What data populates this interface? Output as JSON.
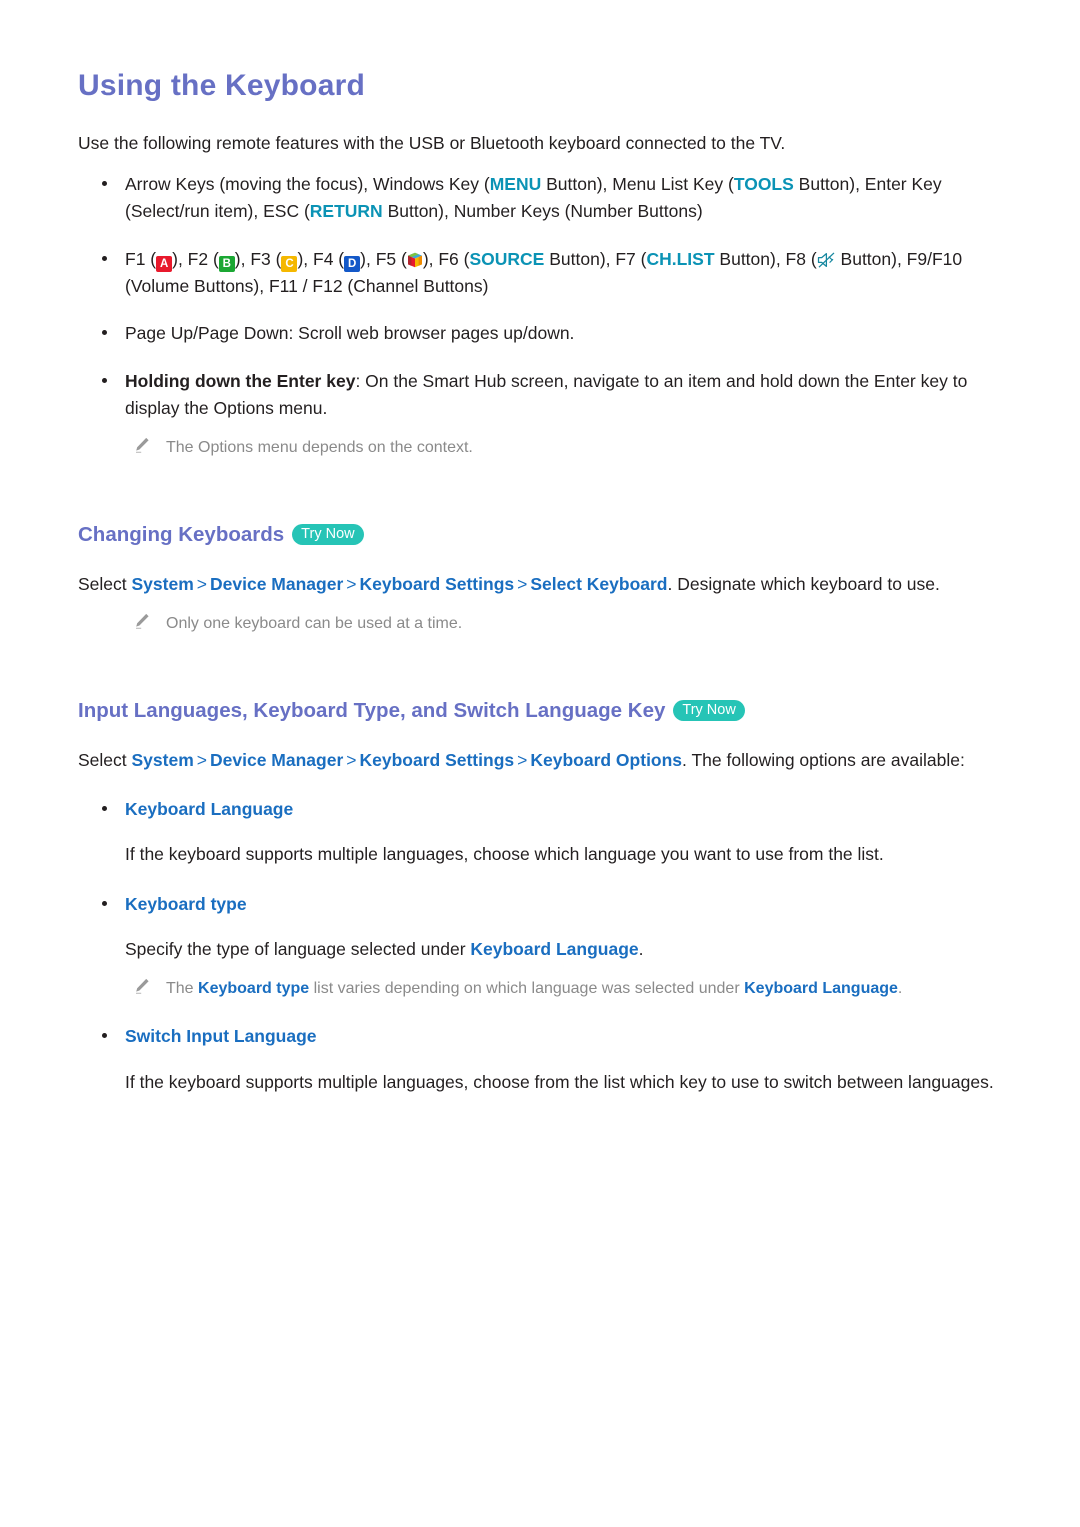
{
  "document": {
    "title": "Using the Keyboard",
    "intro": "Use the following remote features with the USB or Bluetooth keyboard connected to the TV."
  },
  "colors": {
    "heading_purple": "#6770c4",
    "keyword_teal": "#0b93b5",
    "link_blue": "#1a6ec0",
    "trynow_badge": "#26c4b6",
    "note_gray": "#8a8a8a",
    "badge_a_red": "#e8192c",
    "badge_b_green": "#1ba733",
    "badge_c_yellow": "#f5b800",
    "badge_d_blue": "#1358c8",
    "body_text": "#231f20"
  },
  "bullets": {
    "arrow_keys": {
      "p1": "Arrow Keys (moving the focus), Windows Key (",
      "kw1": "MENU",
      "p2": " Button), Menu List Key (",
      "kw2": "TOOLS",
      "p3": " Button), Enter Key (Select/run item), ESC (",
      "kw3": "RETURN",
      "p4": " Button), Number Keys (Number Buttons)"
    },
    "function_keys": {
      "p1": "F1 (",
      "badge_a": "A",
      "p2": "), F2 (",
      "badge_b": "B",
      "p3": "), F3 (",
      "badge_c": "C",
      "p4": "), F4 (",
      "badge_d": "D",
      "p5": "), F5 (",
      "p6": "), F6 (",
      "kw_source": "SOURCE",
      "p7": " Button), F7 (",
      "kw_chlist": "CH.LIST",
      "p8": " Button), F8 (",
      "p9": " Button), F9/F10 (Volume Buttons), F11 / F12 (Channel Buttons)"
    },
    "page_updown": "Page Up/Page Down: Scroll web browser pages up/down.",
    "holding_enter": {
      "bold": "Holding down the Enter key",
      "rest": ": On the Smart Hub screen, navigate to an item and hold down the Enter key to display the Options menu."
    }
  },
  "notes": {
    "options_context": "The Options menu depends on the context.",
    "one_keyboard": "Only one keyboard can be used at a time.",
    "keyboard_type_note": {
      "p1": "The ",
      "kw1": "Keyboard type",
      "p2": " list varies depending on which language was selected under ",
      "kw2": "Keyboard Language",
      "p3": "."
    }
  },
  "sections": [
    {
      "heading": "Changing Keyboards",
      "trynow_label": "Try Now",
      "path": {
        "select": "Select ",
        "items": [
          "System",
          "Device Manager",
          "Keyboard Settings",
          "Select Keyboard"
        ],
        "separator": ">",
        "tail": ". Designate which keyboard to use."
      }
    },
    {
      "heading": "Input Languages, Keyboard Type, and Switch Language Key",
      "trynow_label": "Try Now",
      "path": {
        "select": "Select ",
        "items": [
          "System",
          "Device Manager",
          "Keyboard Settings",
          "Keyboard Options"
        ],
        "separator": ">",
        "tail": ". The following options are available:"
      }
    }
  ],
  "options": [
    {
      "name": "Keyboard Language",
      "description": "If the keyboard supports multiple languages, choose which language you want to use from the list."
    },
    {
      "name": "Keyboard type",
      "description_pre": "Specify the type of language selected under ",
      "description_link": "Keyboard Language",
      "description_post": "."
    },
    {
      "name": "Switch Input Language",
      "description": "If the keyboard supports multiple languages, choose from the list which key to use to switch between languages."
    }
  ],
  "icons": {
    "pencil": "pencil-icon",
    "smart_hub": "smart-hub-cube-icon",
    "mute": "mute-speaker-icon"
  }
}
